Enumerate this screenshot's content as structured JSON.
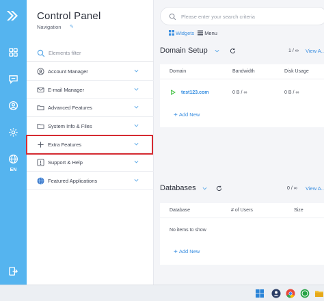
{
  "app": {
    "title": "Control Panel",
    "subtitle": "Navigation",
    "filter_placeholder": "Elements filter",
    "lang": "EN"
  },
  "colors": {
    "rail": "#55b4ef",
    "accent": "#3a8ee0",
    "highlight": "#d52b32"
  },
  "rail_icons": [
    "logo-arrows-icon",
    "dashboard-grid-icon",
    "chat-icon",
    "user-circle-icon",
    "gear-icon",
    "globe-icon",
    "logout-icon"
  ],
  "menu": [
    {
      "label": "Account Manager",
      "icon": "user-circle-icon"
    },
    {
      "label": "E-mail Manager",
      "icon": "mail-icon"
    },
    {
      "label": "Advanced Features",
      "icon": "folder-icon"
    },
    {
      "label": "System Info & Files",
      "icon": "folder-icon"
    },
    {
      "label": "Extra Features",
      "icon": "plus-icon"
    },
    {
      "label": "Support & Help",
      "icon": "help-icon"
    },
    {
      "label": "Featured Applications",
      "icon": "app-globe-icon"
    }
  ],
  "search": {
    "placeholder": "Please enter your search criteria"
  },
  "view": {
    "widgets": "Widgets",
    "menu": "Menu"
  },
  "domain_setup": {
    "title": "Domain Setup",
    "pager": "1  /  ∞",
    "view_all": "View A...",
    "columns": [
      "Domain",
      "Bandwidth",
      "Disk Usage"
    ],
    "rows": [
      {
        "domain": "test123.com",
        "bandwidth": "0 B  /  ∞",
        "disk": "0 B  /  ∞"
      }
    ],
    "add_new": "Add New"
  },
  "databases": {
    "title": "Databases",
    "pager": "0  /  ∞",
    "view_all": "View A...",
    "columns": [
      "Database",
      "# of Users",
      "Size"
    ],
    "empty": "No items to show",
    "add_new": "Add New"
  }
}
